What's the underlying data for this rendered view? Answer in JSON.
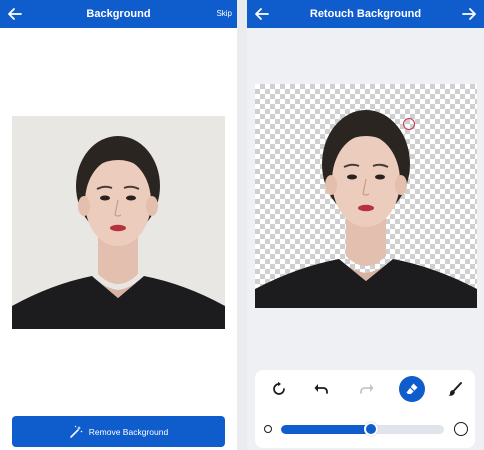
{
  "left_screen": {
    "title": "Background",
    "back_icon": "arrow-left-icon",
    "skip_label": "Skip",
    "photo_background": "#e8e7e4",
    "remove_button": {
      "icon": "magic-wand-icon",
      "label": "Remove Background"
    }
  },
  "right_screen": {
    "title": "Retouch Background",
    "back_icon": "arrow-left-icon",
    "next_icon": "arrow-right-icon",
    "toolbar": {
      "tools": [
        "reset-icon",
        "undo-icon",
        "redo-icon",
        "eraser-icon",
        "brush-icon"
      ],
      "active_tool": "eraser-icon",
      "brush_size_level": 0.55
    }
  },
  "colors": {
    "accent": "#0f5ccc",
    "accent_text": "#ffffff"
  }
}
